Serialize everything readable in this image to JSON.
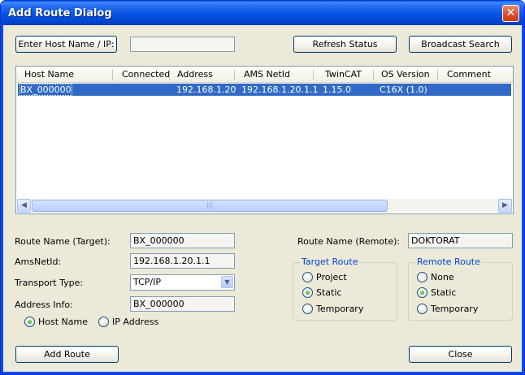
{
  "window": {
    "title": "Add Route Dialog",
    "close_glyph": "✕"
  },
  "toolbar": {
    "enter_host_label": "Enter Host Name / IP:",
    "host_value": "",
    "refresh_label": "Refresh Status",
    "broadcast_label": "Broadcast Search"
  },
  "list": {
    "columns": [
      "Host Name",
      "Connected",
      "Address",
      "AMS NetId",
      "TwinCAT",
      "OS Version",
      "Comment"
    ],
    "rows": [
      {
        "host": "BX_000000",
        "connected": "",
        "address": "192.168.1.20",
        "ams": "192.168.1.20.1.1",
        "twincat": "1.15.0",
        "os": "C16X (1.0)",
        "comment": ""
      }
    ],
    "scroll_grip": "|||"
  },
  "form": {
    "route_name_target_label": "Route Name (Target):",
    "route_name_target_value": "BX_000000",
    "amsnetid_label": "AmsNetId:",
    "amsnetid_value": "192.168.1.20.1.1",
    "transport_label": "Transport Type:",
    "transport_value": "TCP/IP",
    "address_info_label": "Address Info:",
    "address_info_value": "BX_000000",
    "host_name_radio": "Host Name",
    "ip_address_radio": "IP Address",
    "route_name_remote_label": "Route Name (Remote):",
    "route_name_remote_value": "DOKTORAT"
  },
  "target_route": {
    "title": "Target Route",
    "project": "Project",
    "static": "Static",
    "temporary": "Temporary",
    "selected": "static"
  },
  "remote_route": {
    "title": "Remote Route",
    "none": "None",
    "static": "Static",
    "temporary": "Temporary",
    "selected": "static"
  },
  "footer": {
    "add_route_label": "Add Route",
    "close_label": "Close"
  },
  "icons": {
    "close": "close-icon",
    "scroll_left": "chevron-left-icon",
    "scroll_right": "chevron-right-icon",
    "dropdown": "chevron-down-icon"
  },
  "colors": {
    "titlebar": "#0553e3",
    "selection": "#316ac5",
    "group_title": "#0046d5",
    "dialog_bg": "#ece9d8"
  }
}
